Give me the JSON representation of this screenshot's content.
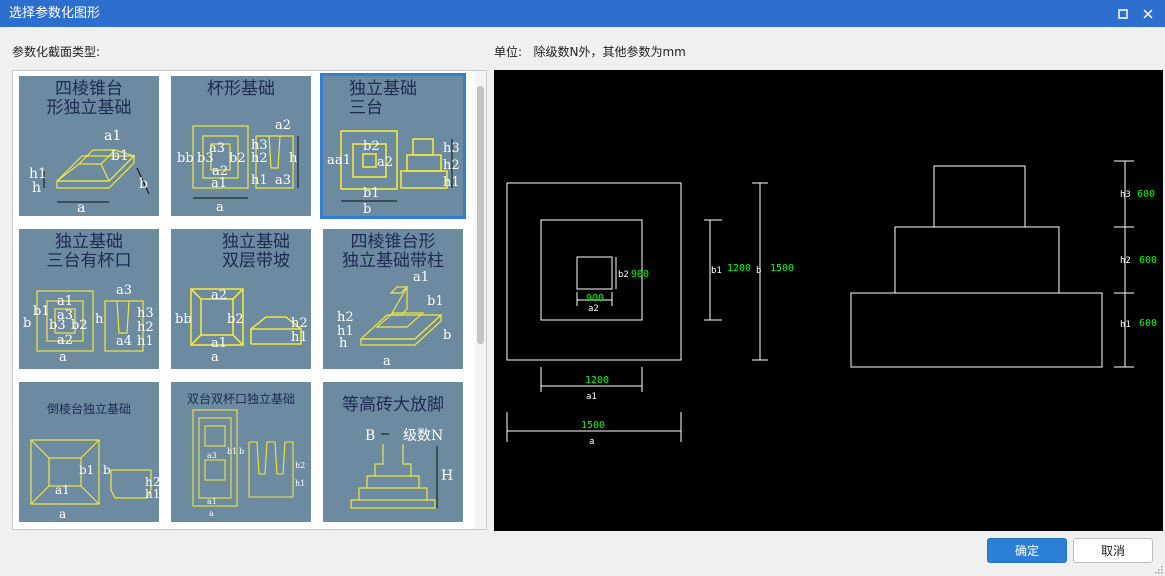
{
  "window": {
    "title": "选择参数化图形",
    "maximize_icon": "maximize-icon",
    "close_icon": "close-icon"
  },
  "left": {
    "label": "参数化截面类型:"
  },
  "right": {
    "label": "单位:   除级数N外，其他参数为mm"
  },
  "shapes": [
    {
      "title": "四棱锥台\n形独立基础",
      "selected": false
    },
    {
      "title": "杯形基础",
      "selected": false
    },
    {
      "title": "独立基础\n三台",
      "selected": true
    },
    {
      "title": "独立基础\n三台有杯口",
      "selected": false
    },
    {
      "title": "独立基础\n双层带坡",
      "selected": false
    },
    {
      "title": "四棱锥台形\n独立基础带柱",
      "selected": false
    },
    {
      "title": "倒棱台独立基础",
      "selected": false
    },
    {
      "title": "双台双杯口独立基础",
      "selected": false
    },
    {
      "title": "等高砖大放脚",
      "selected": false
    }
  ],
  "thumb_labels": {
    "a": "a",
    "b": "b",
    "a1": "a1",
    "b1": "b1",
    "a2": "a2",
    "b2": "b2",
    "a3": "a3",
    "b3": "b3",
    "a4": "a4",
    "h": "h",
    "h1": "h1",
    "h2": "h2",
    "h3": "h3",
    "bb": "bb",
    "B": "B",
    "H": "H",
    "N": "级数N"
  },
  "preview": {
    "dims": {
      "a2_val": "900",
      "a2": "a2",
      "b2_val": "900",
      "b2": "b2",
      "b1_val": "1200",
      "b1": "b1",
      "b_val": "1500",
      "b": "b",
      "a1_val": "1200",
      "a1": "a1",
      "a_val": "1500",
      "a": "a",
      "h3_val": "600",
      "h3": "h3",
      "h2_val": "600",
      "h2": "h2",
      "h1_val": "600",
      "h1": "h1"
    },
    "colors": {
      "line": "#ffffff",
      "value": "#00ff00",
      "background": "#000000"
    }
  },
  "buttons": {
    "ok": "确定",
    "cancel": "取消"
  },
  "colors": {
    "titlebar": "#2c6fcf",
    "accent": "#2c7fd6",
    "thumb_bg": "#6c8aa0",
    "thumb_line": "#f0e640"
  }
}
